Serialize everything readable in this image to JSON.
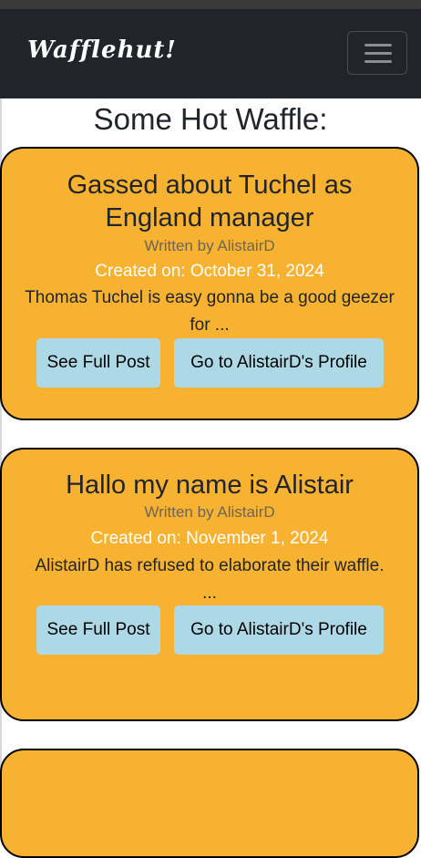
{
  "navbar": {
    "brand": "Wafflehut!",
    "toggle_icon": "hamburger-menu-icon"
  },
  "page": {
    "title": "Some Hot Waffle:"
  },
  "posts": [
    {
      "title_line1": "Gassed about Tuchel as",
      "title_line2": "England manager",
      "author": "Written by AlistairD",
      "date": "Created on: October 31, 2024",
      "excerpt_line1": "Thomas Tuchel is easy gonna be a good geezer",
      "excerpt_line2": "for ...",
      "see_post_label": "See Full Post",
      "profile_label": "Go to AlistairD's Profile"
    },
    {
      "title_line1": "Hallo my name is Alistair",
      "author": "Written by AlistairD",
      "date": "Created on: November 1, 2024",
      "excerpt_line1": "AlistairD has refused to elaborate their waffle.",
      "excerpt_line2": "...",
      "see_post_label": "See Full Post",
      "profile_label": "Go to AlistairD's Profile"
    }
  ],
  "colors": {
    "navbar_bg": "#212529",
    "card_bg": "#f8b232",
    "button_bg": "#add8e6",
    "date_text": "#ffffff"
  }
}
